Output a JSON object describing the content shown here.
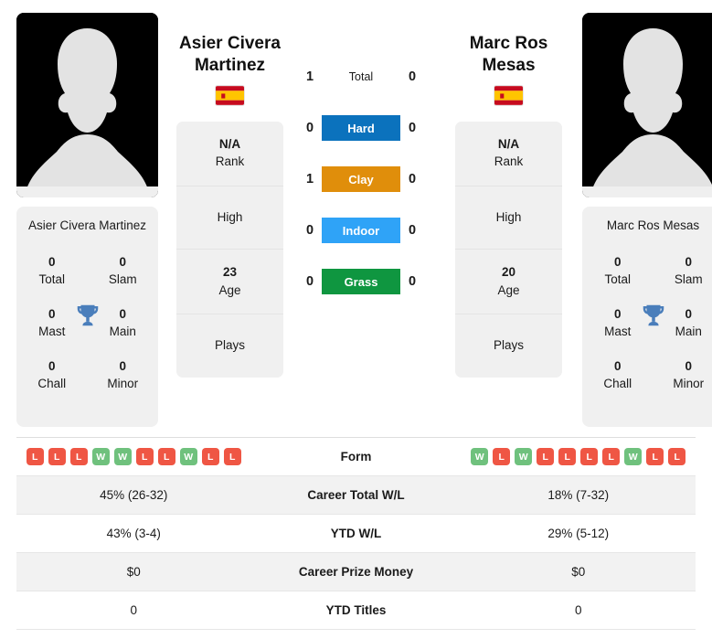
{
  "players": {
    "left": {
      "name": "Asier Civera Martinez",
      "name_line1": "Asier Civera",
      "name_line2": "Martinez",
      "country": "Spain",
      "flag": "spain-flag",
      "avatar": "player-silhouette",
      "titles": {
        "total_value": "0",
        "total_label": "Total",
        "slam_value": "0",
        "slam_label": "Slam",
        "mast_value": "0",
        "mast_label": "Mast",
        "main_value": "0",
        "main_label": "Main",
        "chall_value": "0",
        "chall_label": "Chall",
        "minor_value": "0",
        "minor_label": "Minor"
      },
      "info": {
        "rank_value": "N/A",
        "rank_label": "Rank",
        "high_label": "High",
        "high_value": "",
        "age_value": "23",
        "age_label": "Age",
        "plays_label": "Plays",
        "plays_value": ""
      },
      "form": [
        "L",
        "L",
        "L",
        "W",
        "W",
        "L",
        "L",
        "W",
        "L",
        "L"
      ],
      "career_total_wl": "45% (26-32)",
      "ytd_wl": "43% (3-4)",
      "career_prize_money": "$0",
      "ytd_titles": "0"
    },
    "right": {
      "name": "Marc Ros Mesas",
      "name_line1": "Marc Ros",
      "name_line2": "Mesas",
      "country": "Spain",
      "flag": "spain-flag",
      "avatar": "player-silhouette",
      "titles": {
        "total_value": "0",
        "total_label": "Total",
        "slam_value": "0",
        "slam_label": "Slam",
        "mast_value": "0",
        "mast_label": "Mast",
        "main_value": "0",
        "main_label": "Main",
        "chall_value": "0",
        "chall_label": "Chall",
        "minor_value": "0",
        "minor_label": "Minor"
      },
      "info": {
        "rank_value": "N/A",
        "rank_label": "Rank",
        "high_label": "High",
        "high_value": "",
        "age_value": "20",
        "age_label": "Age",
        "plays_label": "Plays",
        "plays_value": ""
      },
      "form": [
        "W",
        "L",
        "W",
        "L",
        "L",
        "L",
        "L",
        "W",
        "L",
        "L"
      ],
      "career_total_wl": "18% (7-32)",
      "ytd_wl": "29% (5-12)",
      "career_prize_money": "$0",
      "ytd_titles": "0"
    }
  },
  "head_to_head": {
    "rows": [
      {
        "label": "Total",
        "left": "1",
        "right": "0",
        "color": "",
        "style": "plain"
      },
      {
        "label": "Hard",
        "left": "0",
        "right": "0",
        "color": "#0b72bd",
        "style": "bar"
      },
      {
        "label": "Clay",
        "left": "1",
        "right": "0",
        "color": "#e08e0b",
        "style": "bar"
      },
      {
        "label": "Indoor",
        "left": "0",
        "right": "0",
        "color": "#2fa3f7",
        "style": "bar"
      },
      {
        "label": "Grass",
        "left": "0",
        "right": "0",
        "color": "#0f9640",
        "style": "bar"
      }
    ]
  },
  "stats_table": {
    "rows": [
      {
        "label": "Form",
        "type": "form"
      },
      {
        "label": "Career Total W/L",
        "type": "text",
        "key": "career_total_wl"
      },
      {
        "label": "YTD W/L",
        "type": "text",
        "key": "ytd_wl"
      },
      {
        "label": "Career Prize Money",
        "type": "text",
        "key": "career_prize_money"
      },
      {
        "label": "YTD Titles",
        "type": "text",
        "key": "ytd_titles"
      }
    ]
  },
  "colors": {
    "hard": "#0b72bd",
    "clay": "#e08e0b",
    "indoor": "#2fa3f7",
    "grass": "#0f9640",
    "win_badge": "#6fc17d",
    "loss_badge": "#ef5644",
    "card_bg": "#f0f0f0",
    "row_alt_bg": "#f2f2f2",
    "trophy": "#4a7ebb"
  }
}
